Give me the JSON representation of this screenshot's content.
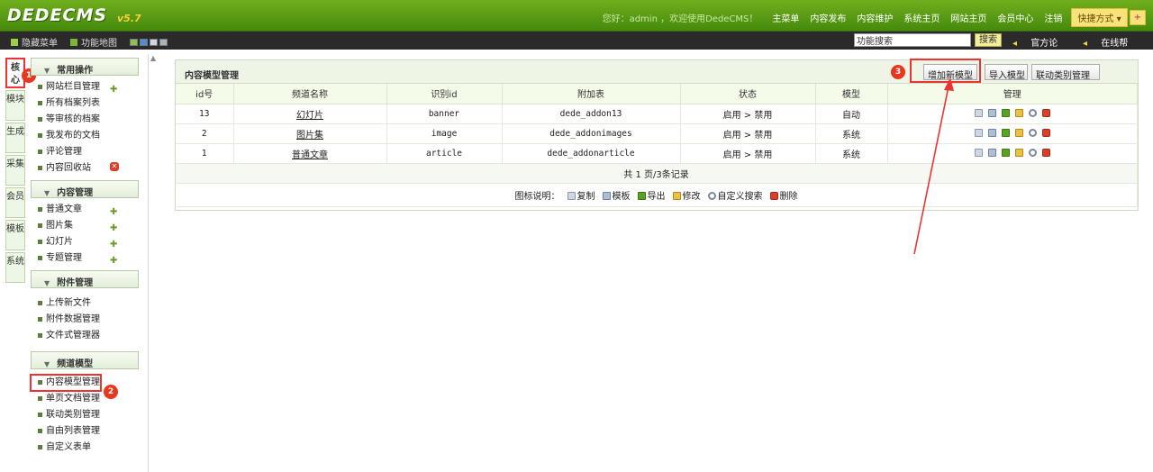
{
  "topbar": {
    "logo": "DEDECMS",
    "version": "v5.7",
    "welcome": "您好：admin ，欢迎使用DedeCMS！",
    "links": [
      "主菜单",
      "内容发布",
      "内容维护",
      "系统主页",
      "网站主页",
      "会员中心",
      "注销"
    ],
    "quick_menu": "快捷方式 ▾",
    "quick_add": "+"
  },
  "subbar": {
    "hide_menu": "隐藏菜单",
    "site_map": "功能地图",
    "search_value": "功能搜索",
    "search_button": "搜索",
    "forum": "官方论坛",
    "help": "在线帮助"
  },
  "left_tabs": [
    "核心",
    "模块",
    "生成",
    "采集",
    "会员",
    "模板",
    "系统"
  ],
  "menu": {
    "sections": [
      {
        "title": "常用操作",
        "items": [
          "网站栏目管理",
          "所有档案列表",
          "等审核的档案",
          "我发布的文档",
          "评论管理",
          "内容回收站"
        ]
      },
      {
        "title": "内容管理",
        "items": [
          "普通文章",
          "图片集",
          "幻灯片",
          "专题管理"
        ]
      },
      {
        "title": "附件管理",
        "items": [
          "上传新文件",
          "附件数据管理",
          "文件式管理器"
        ]
      },
      {
        "title": "频道模型",
        "items": [
          "内容模型管理",
          "单页文档管理",
          "联动类别管理",
          "自由列表管理",
          "自定义表单"
        ]
      }
    ]
  },
  "annotations": [
    "1",
    "2",
    "3"
  ],
  "panel": {
    "title": "内容模型管理",
    "buttons": {
      "add": "增加新模型",
      "import": "导入模型",
      "linkage": "联动类别管理"
    },
    "columns": [
      "id号",
      "频道名称",
      "识别id",
      "附加表",
      "状态",
      "模型",
      "管理"
    ],
    "rows": [
      {
        "id": "13",
        "name": "幻灯片",
        "nid": "banner",
        "table": "dede_addon13",
        "status": "启用 > 禁用",
        "model": "自动"
      },
      {
        "id": "2",
        "name": "图片集",
        "nid": "image",
        "table": "dede_addonimages",
        "status": "启用 > 禁用",
        "model": "系统"
      },
      {
        "id": "1",
        "name": "普通文章",
        "nid": "article",
        "table": "dede_addonarticle",
        "status": "启用 > 禁用",
        "model": "系统"
      }
    ],
    "pagination": "共 1 页/3条记录",
    "legend": {
      "label": "图标说明：",
      "copy": "复制",
      "template": "模板",
      "export": "导出",
      "edit": "修改",
      "search": "自定义搜索",
      "delete": "删除"
    }
  }
}
